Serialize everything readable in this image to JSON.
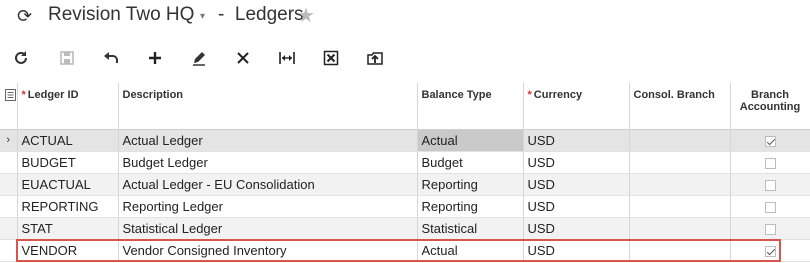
{
  "header": {
    "refresh_glyph": "⟳",
    "company": "Revision Two HQ",
    "caret": "▾",
    "separator": "-",
    "screen_title": "Ledgers",
    "star_glyph": "★"
  },
  "toolbar": {
    "items": [
      "refresh-icon",
      "save-icon",
      "undo-icon",
      "add-icon",
      "edit-icon",
      "delete-icon",
      "fit-to-screen-icon",
      "export-to-excel-icon",
      "import-icon"
    ]
  },
  "grid": {
    "columns": {
      "notes_icon": "notes-icon",
      "ledger_id": "Ledger ID",
      "description": "Description",
      "balance_type": "Balance Type",
      "currency": "Currency",
      "consol_branch": "Consol. Branch",
      "branch_accounting": "Branch Accounting"
    },
    "required_marker": "*",
    "current_row_marker": "›",
    "rows": [
      {
        "ledger_id": "ACTUAL",
        "description": "Actual Ledger",
        "balance_type": "Actual",
        "currency": "USD",
        "consol_branch": "",
        "branch_accounting": true
      },
      {
        "ledger_id": "BUDGET",
        "description": "Budget Ledger",
        "balance_type": "Budget",
        "currency": "USD",
        "consol_branch": "",
        "branch_accounting": false
      },
      {
        "ledger_id": "EUACTUAL",
        "description": "Actual Ledger - EU Consolidation",
        "balance_type": "Reporting",
        "currency": "USD",
        "consol_branch": "",
        "branch_accounting": false
      },
      {
        "ledger_id": "REPORTING",
        "description": "Reporting Ledger",
        "balance_type": "Reporting",
        "currency": "USD",
        "consol_branch": "",
        "branch_accounting": false
      },
      {
        "ledger_id": "STAT",
        "description": "Statistical Ledger",
        "balance_type": "Statistical",
        "currency": "USD",
        "consol_branch": "",
        "branch_accounting": false
      },
      {
        "ledger_id": "VENDOR",
        "description": "Vendor Consigned Inventory",
        "balance_type": "Actual",
        "currency": "USD",
        "consol_branch": "",
        "branch_accounting": true
      }
    ]
  },
  "colors": {
    "highlight_border": "#d9534f",
    "required_asterisk": "#d9332f"
  }
}
